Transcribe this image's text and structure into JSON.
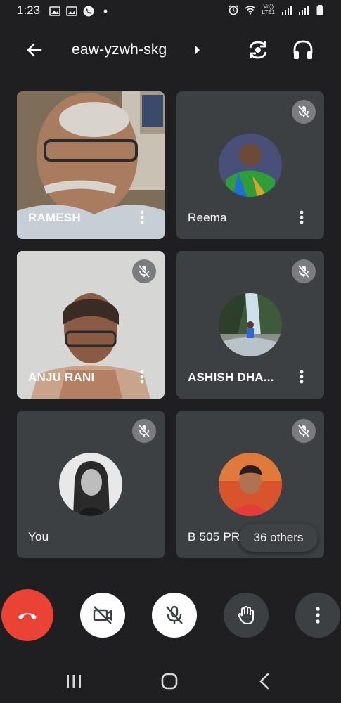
{
  "status_bar": {
    "time": "1:23",
    "network_label_top": "Vo))",
    "network_label_bottom": "LTE1"
  },
  "header": {
    "meeting_code": "eaw-yzwh-skg",
    "icons": [
      "back-arrow-icon",
      "caret-right-icon",
      "switch-camera-icon",
      "headphones-icon"
    ]
  },
  "participants": [
    {
      "name": "RAMESH",
      "muted": false,
      "video": true
    },
    {
      "name": "Reema",
      "muted": true,
      "video": false
    },
    {
      "name": "ANJU RANI",
      "muted": true,
      "video": true
    },
    {
      "name": "ASHISH DHA...",
      "muted": true,
      "video": false
    },
    {
      "name": "You",
      "muted": true,
      "video": false
    },
    {
      "name": "B 505 PR",
      "muted": true,
      "video": false
    }
  ],
  "others_label": "36 others",
  "controls": {
    "icons": [
      "end-call-icon",
      "camera-off-icon",
      "mic-off-icon",
      "raise-hand-icon",
      "more-vert-icon"
    ],
    "colors": {
      "end": "#ea4335",
      "light": "#ffffff",
      "dark": "#3c4043"
    }
  },
  "nav_bar": {
    "icons": [
      "recents-icon",
      "home-icon",
      "back-icon"
    ]
  }
}
